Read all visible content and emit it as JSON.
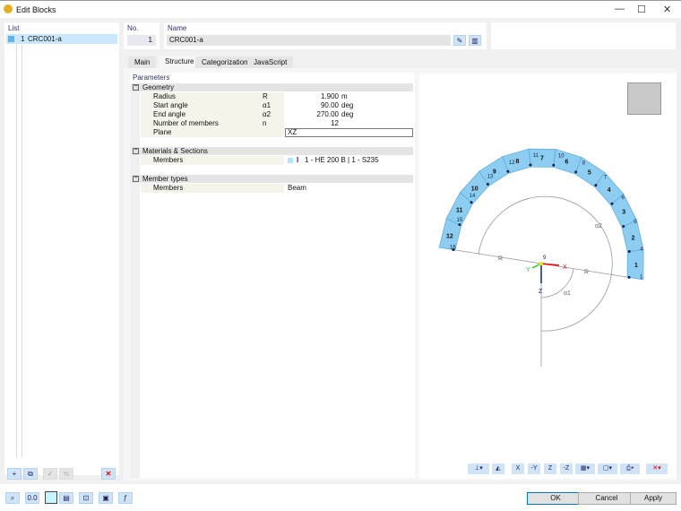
{
  "window": {
    "title": "Edit Blocks",
    "icon": "blocks-app-icon"
  },
  "list": {
    "header": "List",
    "items": [
      {
        "no": "1",
        "name": "CRC001-a",
        "color": "#5bb8e8"
      }
    ]
  },
  "header": {
    "no_label": "No.",
    "no_value": "1",
    "name_label": "Name",
    "name_value": "CRC001-a"
  },
  "tabs": [
    {
      "label": "Main"
    },
    {
      "label": "Structure",
      "active": true
    },
    {
      "label": "Categorization"
    },
    {
      "label": "JavaScript"
    }
  ],
  "parameters": {
    "title": "Parameters",
    "groups": [
      {
        "label": "Geometry",
        "rows": [
          {
            "name": "Radius",
            "symbol": "R",
            "value": "1.900",
            "unit": "m"
          },
          {
            "name": "Start angle",
            "symbol": "α1",
            "value": "90.00",
            "unit": "deg"
          },
          {
            "name": "End angle",
            "symbol": "α2",
            "value": "270.00",
            "unit": "deg"
          },
          {
            "name": "Number of members",
            "symbol": "n",
            "value": "12",
            "unit": ""
          },
          {
            "name": "Plane",
            "symbol": "",
            "value": "XZ",
            "unit": ""
          }
        ]
      },
      {
        "label": "Materials & Sections",
        "rows": [
          {
            "name": "Members",
            "value": "1 - HE 200 B | 1 - S235"
          }
        ]
      },
      {
        "label": "Member types",
        "rows": [
          {
            "name": "Members",
            "value": "Beam"
          }
        ]
      }
    ]
  },
  "viewport": {
    "member_labels": [
      "1",
      "2",
      "3",
      "4",
      "5",
      "6",
      "7",
      "8",
      "9",
      "10",
      "11",
      "12"
    ],
    "node_labels": [
      "1",
      "4",
      "5",
      "6",
      "7",
      "8",
      "10",
      "11",
      "12",
      "13",
      "14",
      "15",
      "16"
    ],
    "origin_node": "9",
    "dim_labels": {
      "radius": "R",
      "start_angle": "α1",
      "end_angle": "α2"
    },
    "axes": {
      "x": "X",
      "y": "Y",
      "z": "Z"
    },
    "member_color": "#8ecdf2"
  },
  "view_toolbar": [
    "axes-dropdown",
    "view-settings",
    "view-x",
    "view-minus-y",
    "view-z",
    "view-minus-z",
    "render-dropdown",
    "box-dropdown",
    "print-dropdown",
    "selection-dropdown"
  ],
  "view_toolbar_labels": {
    "x": "X",
    "my": "-Y",
    "z": "Z",
    "mz": "-Z"
  },
  "buttons": {
    "ok": "OK",
    "cancel": "Cancel",
    "apply": "Apply"
  }
}
